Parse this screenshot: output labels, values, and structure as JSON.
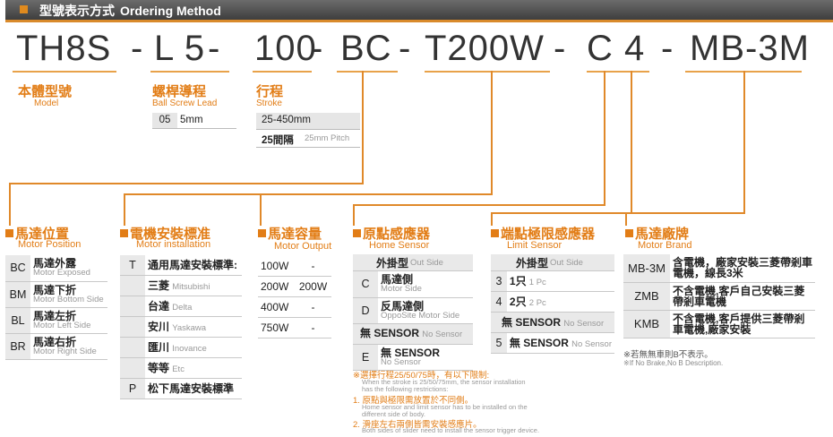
{
  "header": {
    "title_cn": "型號表示方式",
    "title_en": "Ordering Method"
  },
  "code": {
    "series": "TH8S",
    "d1": "-",
    "lead_code": "L 5",
    "d2": "-",
    "stroke": "100",
    "d3": "-",
    "position": "BC",
    "d4": "-",
    "output": "T200W",
    "d5": "-",
    "sensor": "C 4",
    "d6": "-",
    "brand": "MB-3M"
  },
  "model_label": {
    "cn": "本體型號",
    "en": "Model"
  },
  "lead_label": {
    "cn": "螺桿導程",
    "en": "Ball Screw Lead"
  },
  "lead_table": [
    {
      "code": "05",
      "value": "5mm"
    }
  ],
  "stroke_label": {
    "cn": "行程",
    "en": "Stroke"
  },
  "stroke_table": {
    "range": "25-450mm",
    "pitch_cn": "25間隔",
    "pitch_en": "25mm Pitch"
  },
  "motor_position": {
    "title_cn": "馬達位置",
    "title_en": "Motor Position",
    "rows": [
      {
        "code": "BC",
        "cn": "馬達外露",
        "en": "Motor Exposed"
      },
      {
        "code": "BM",
        "cn": "馬達下折",
        "en": "Motor Bottom Side"
      },
      {
        "code": "BL",
        "cn": "馬達左折",
        "en": "Motor Left Side"
      },
      {
        "code": "BR",
        "cn": "馬達右折",
        "en": "Motor Right Side"
      }
    ]
  },
  "motor_install": {
    "title_cn": "電機安裝標准",
    "title_en": "Motor installation",
    "rows": [
      {
        "code": "T",
        "cn": "通用馬達安裝標準:",
        "en": ""
      },
      {
        "code": "",
        "cn": "三菱",
        "en": "Mitsubishi"
      },
      {
        "code": "",
        "cn": "台達",
        "en": "Delta"
      },
      {
        "code": "",
        "cn": "安川",
        "en": "Yaskawa"
      },
      {
        "code": "",
        "cn": "匯川",
        "en": "Inovance"
      },
      {
        "code": "",
        "cn": "等等",
        "en": "Etc"
      },
      {
        "code": "P",
        "cn": "松下馬達安裝標準",
        "en": ""
      }
    ]
  },
  "motor_output": {
    "title_cn": "馬達容量",
    "title_en": "Motor Output",
    "rows": [
      {
        "a": "100W",
        "b": "-"
      },
      {
        "a": "200W",
        "b": "200W"
      },
      {
        "a": "400W",
        "b": "-"
      },
      {
        "a": "750W",
        "b": "-"
      }
    ]
  },
  "home_sensor": {
    "title_cn": "原點感應器",
    "title_en": "Home Sensor",
    "head_cn": "外掛型",
    "head_en": "Out Side",
    "rows": [
      {
        "code": "C",
        "cn": "馬達側",
        "en": "Motor Side"
      },
      {
        "code": "D",
        "cn": "反馬達側",
        "en": "OppoSite Motor Side"
      },
      {
        "code": "",
        "cn": "無 SENSOR",
        "en": "No Sensor"
      },
      {
        "code": "E",
        "cn": "無  SENSOR",
        "en": "No Sensor"
      }
    ]
  },
  "limit_sensor": {
    "title_cn": "端點極限感應器",
    "title_en": "Limit Sensor",
    "head_cn": "外掛型",
    "head_en": "Out Side",
    "rows": [
      {
        "code": "3",
        "cn": "1只",
        "en": "1 Pc"
      },
      {
        "code": "4",
        "cn": "2只",
        "en": "2 Pc"
      },
      {
        "code": "",
        "cn": "無 SENSOR",
        "en": "No Sensor"
      },
      {
        "code": "5",
        "cn": "無 SENSOR",
        "en": "No Sensor"
      }
    ]
  },
  "motor_brand": {
    "title_cn": "馬達廠牌",
    "title_en": "Motor Brand",
    "rows": [
      {
        "code": "MB-3M",
        "cn": "含電機，廠家安裝三菱帶剎車電機，線長3米"
      },
      {
        "code": "ZMB",
        "cn": "不含電機,客戶自己安裝三菱帶剎車電機"
      },
      {
        "code": "KMB",
        "cn": "不含電機,客戶提供三菱帶剎車電機,廠家安裝"
      }
    ],
    "note_cn": "※若無無車則B不表示。",
    "note_en": "※If No Brake,No B Description."
  },
  "stroke_notes": {
    "head_cn": "※選擇行程25/50/75時，有以下限制:",
    "head_en1": "When the stroke is 25/50/75mm, the sensor installation",
    "head_en2": "has the following restrictions:",
    "n1_cn": "1. 原點與極限需放置於不同側。",
    "n1_en1": "Home sensor and limit sensor has to be installed on the",
    "n1_en2": "different side of body.",
    "n2_cn": "2. 滑座左右兩側皆需安裝感應片。",
    "n2_en": "Both sides of slider need to install the sensor trigger device."
  },
  "colors": {
    "accent": "#e27d16",
    "header_bg": "#4a4a4a"
  }
}
